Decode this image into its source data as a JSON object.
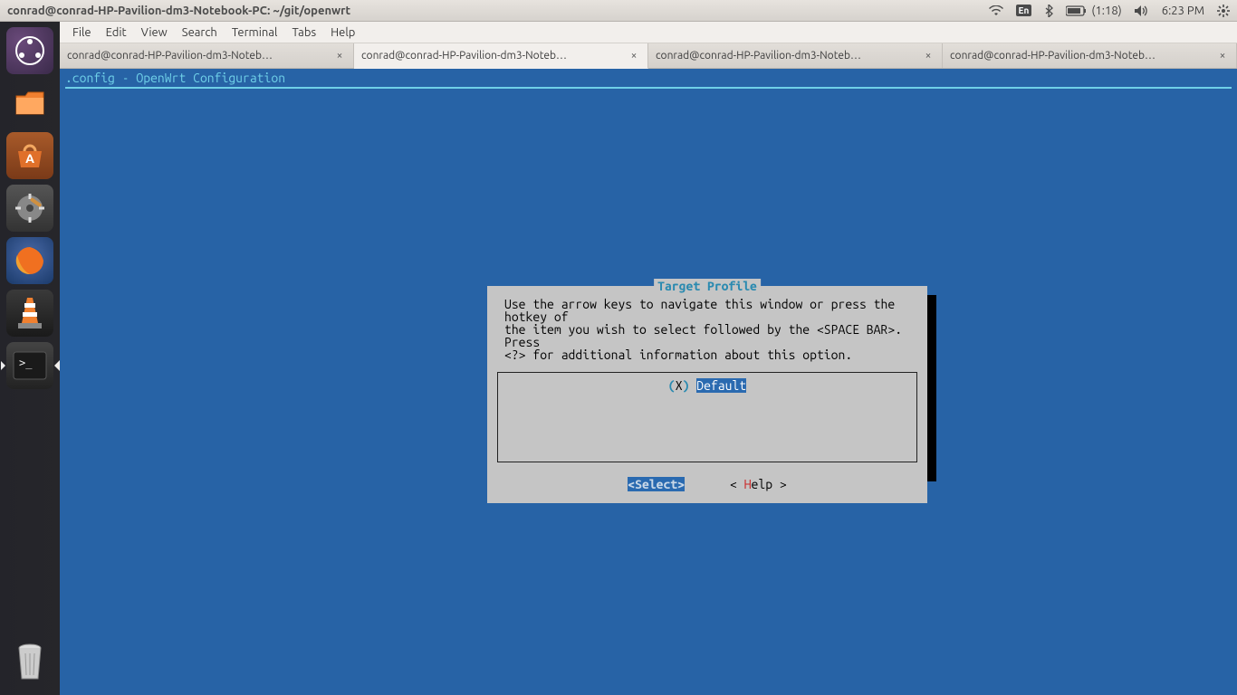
{
  "titlebar": {
    "title": "conrad@conrad-HP-Pavilion-dm3-Notebook-PC: ~/git/openwrt",
    "lang": "En",
    "battery_time": "(1:18)",
    "clock": "6:23 PM"
  },
  "menubar": {
    "items": [
      "File",
      "Edit",
      "View",
      "Search",
      "Terminal",
      "Tabs",
      "Help"
    ]
  },
  "tabs": [
    {
      "label": "conrad@conrad-HP-Pavilion-dm3-Noteb…",
      "active": false
    },
    {
      "label": "conrad@conrad-HP-Pavilion-dm3-Noteb…",
      "active": true
    },
    {
      "label": "conrad@conrad-HP-Pavilion-dm3-Noteb…",
      "active": false
    },
    {
      "label": "conrad@conrad-HP-Pavilion-dm3-Noteb…",
      "active": false
    }
  ],
  "launcher": {
    "items": [
      {
        "name": "dash",
        "semantic": "ubuntu-dash-icon"
      },
      {
        "name": "files",
        "semantic": "files-icon"
      },
      {
        "name": "software",
        "semantic": "software-center-icon"
      },
      {
        "name": "settings",
        "semantic": "system-settings-icon"
      },
      {
        "name": "firefox",
        "semantic": "firefox-icon"
      },
      {
        "name": "vlc",
        "semantic": "vlc-icon"
      },
      {
        "name": "terminal",
        "semantic": "terminal-icon",
        "active": true,
        "running": true
      }
    ],
    "trash": {
      "semantic": "trash-icon"
    }
  },
  "terminal": {
    "config_header": ".config - OpenWrt Configuration"
  },
  "dialog": {
    "title": "Target Profile",
    "instructions": "Use the arrow keys to navigate this window or press the hotkey of\nthe item you wish to select followed by the <SPACE BAR>. Press\n<?> for additional information about this option.",
    "option_marker_open": "(",
    "option_marker_x": "X",
    "option_marker_close": ")",
    "option_label": "Default",
    "select_btn": "<Select>",
    "help_btn_pre": "< ",
    "help_btn_hot": "H",
    "help_btn_post": "elp >"
  }
}
